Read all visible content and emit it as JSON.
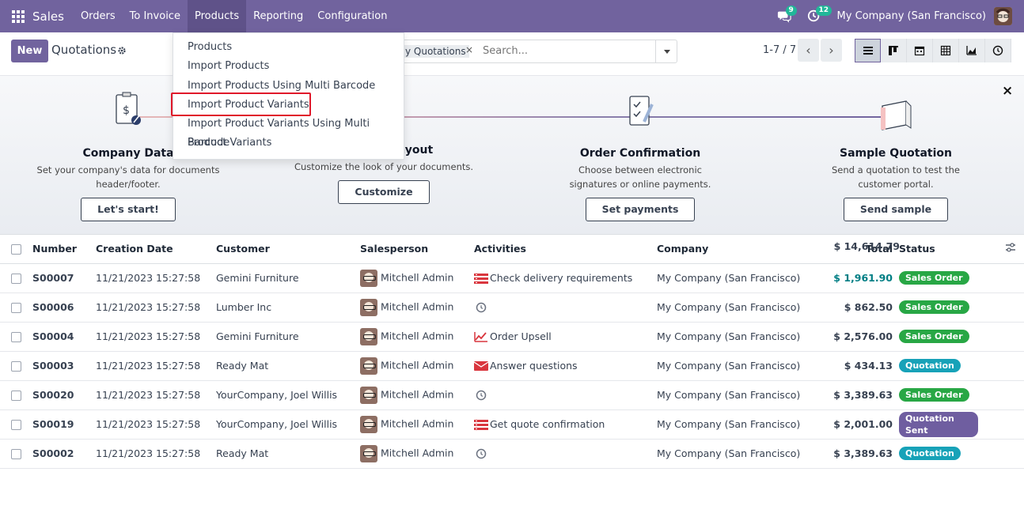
{
  "navbar": {
    "app_name": "Sales",
    "menu": [
      {
        "label": "Orders"
      },
      {
        "label": "To Invoice"
      },
      {
        "label": "Products"
      },
      {
        "label": "Reporting"
      },
      {
        "label": "Configuration"
      }
    ],
    "messages_count": "9",
    "activities_count": "12",
    "company": "My Company (San Francisco)"
  },
  "control": {
    "new_label": "New",
    "title": "Quotations",
    "facet": "y Quotations",
    "facet_remove": "×",
    "search_placeholder": "Search...",
    "pager": "1-7 / 7",
    "prev": "‹",
    "next": "›"
  },
  "products_menu": {
    "items": [
      {
        "label": "Products"
      },
      {
        "label": "Import Products"
      },
      {
        "label": "Import Products Using Multi Barcode"
      },
      {
        "label": "Import Product Variants"
      },
      {
        "label": "Import Product Variants Using Multi Barcode"
      },
      {
        "label": "Product Variants"
      }
    ]
  },
  "onboarding": {
    "close": "×",
    "steps": [
      {
        "title": "Company Data",
        "desc": "Set your company's data for documents header/footer.",
        "button": "Let's start!"
      },
      {
        "title": "ayout",
        "desc": "Customize the look of your documents.",
        "button": "Customize"
      },
      {
        "title": "Order Confirmation",
        "desc": "Choose between electronic signatures or online payments.",
        "button": "Set payments"
      },
      {
        "title": "Sample Quotation",
        "desc": "Send a quotation to test the customer portal.",
        "button": "Send sample"
      }
    ]
  },
  "table": {
    "headers": {
      "number": "Number",
      "date": "Creation Date",
      "customer": "Customer",
      "salesperson": "Salesperson",
      "activities": "Activities",
      "company": "Company",
      "total": "Total",
      "status": "Status"
    },
    "rows": [
      {
        "number": "S00007",
        "date": "11/21/2023 15:27:58",
        "customer": "Gemini Furniture",
        "salesperson": "Mitchell Admin",
        "activity": "Check delivery requirements",
        "activity_icon": "todo-icon",
        "company": "My Company (San Francisco)",
        "total": "$ 1,961.90",
        "status": "Sales Order"
      },
      {
        "number": "S00006",
        "date": "11/21/2023 15:27:58",
        "customer": "Lumber Inc",
        "salesperson": "Mitchell Admin",
        "activity": "",
        "activity_icon": "clock-icon",
        "company": "My Company (San Francisco)",
        "total": "$ 862.50",
        "status": "Sales Order"
      },
      {
        "number": "S00004",
        "date": "11/21/2023 15:27:58",
        "customer": "Gemini Furniture",
        "salesperson": "Mitchell Admin",
        "activity": "Order Upsell",
        "activity_icon": "chart-icon",
        "company": "My Company (San Francisco)",
        "total": "$ 2,576.00",
        "status": "Sales Order"
      },
      {
        "number": "S00003",
        "date": "11/21/2023 15:27:58",
        "customer": "Ready Mat",
        "salesperson": "Mitchell Admin",
        "activity": "Answer questions",
        "activity_icon": "envelope-icon",
        "company": "My Company (San Francisco)",
        "total": "$ 434.13",
        "status": "Quotation"
      },
      {
        "number": "S00020",
        "date": "11/21/2023 15:27:58",
        "customer": "YourCompany, Joel Willis",
        "salesperson": "Mitchell Admin",
        "activity": "",
        "activity_icon": "clock-icon",
        "company": "My Company (San Francisco)",
        "total": "$ 3,389.63",
        "status": "Sales Order"
      },
      {
        "number": "S00019",
        "date": "11/21/2023 15:27:58",
        "customer": "YourCompany, Joel Willis",
        "salesperson": "Mitchell Admin",
        "activity": "Get quote confirmation",
        "activity_icon": "todo-icon",
        "company": "My Company (San Francisco)",
        "total": "$ 2,001.00",
        "status": "Quotation Sent"
      },
      {
        "number": "S00002",
        "date": "11/21/2023 15:27:58",
        "customer": "Ready Mat",
        "salesperson": "Mitchell Admin",
        "activity": "",
        "activity_icon": "clock-icon",
        "company": "My Company (San Francisco)",
        "total": "$ 3,389.63",
        "status": "Quotation"
      }
    ],
    "grand_total": "$ 14,614.79"
  },
  "colors": {
    "brand": "#71639e",
    "sales_order": "#28a745",
    "quotation": "#17a2b8",
    "quotation_sent": "#6f5ea0",
    "highlight": "#e0182a"
  }
}
